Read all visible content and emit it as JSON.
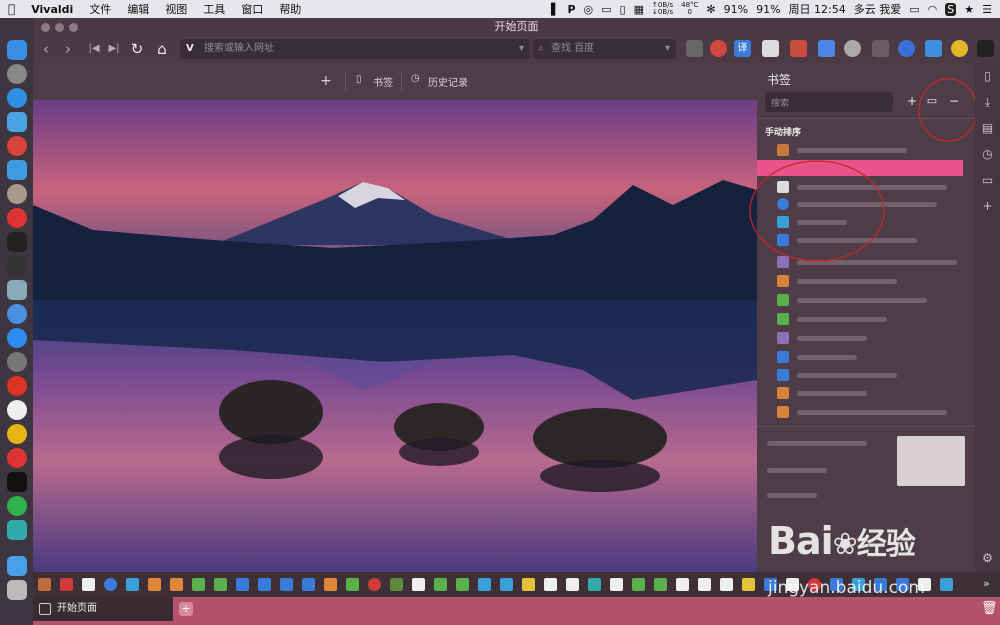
{
  "menubar": {
    "app": "Vivaldi",
    "items": [
      "文件",
      "编辑",
      "视图",
      "工具",
      "窗口",
      "帮助"
    ],
    "net_up": "0B/s",
    "net_down": "0B/s",
    "temp": "48°C",
    "temp_sub": "0",
    "clock": "周日 12:54",
    "weather": "多云 我爱",
    "battery1": "91%",
    "battery2": "91%"
  },
  "window": {
    "title": "开始页面"
  },
  "navbar": {
    "url_placeholder": "搜索或输入网址",
    "search_placeholder": "查找 百度",
    "ext_translate": "译"
  },
  "speeddial": {
    "add": "+",
    "bookmarks": "书签",
    "history": "历史记录"
  },
  "panel": {
    "title": "书签",
    "search_placeholder": "搜索",
    "sort_label": "手动排序"
  },
  "tabs": {
    "active": "开始页面"
  },
  "watermark": {
    "brand": "Bai",
    "brand2": "经验",
    "url": "jingyan.baidu.com"
  },
  "colors": {
    "accent": "#b3526d",
    "panel": "#4e3d47"
  }
}
